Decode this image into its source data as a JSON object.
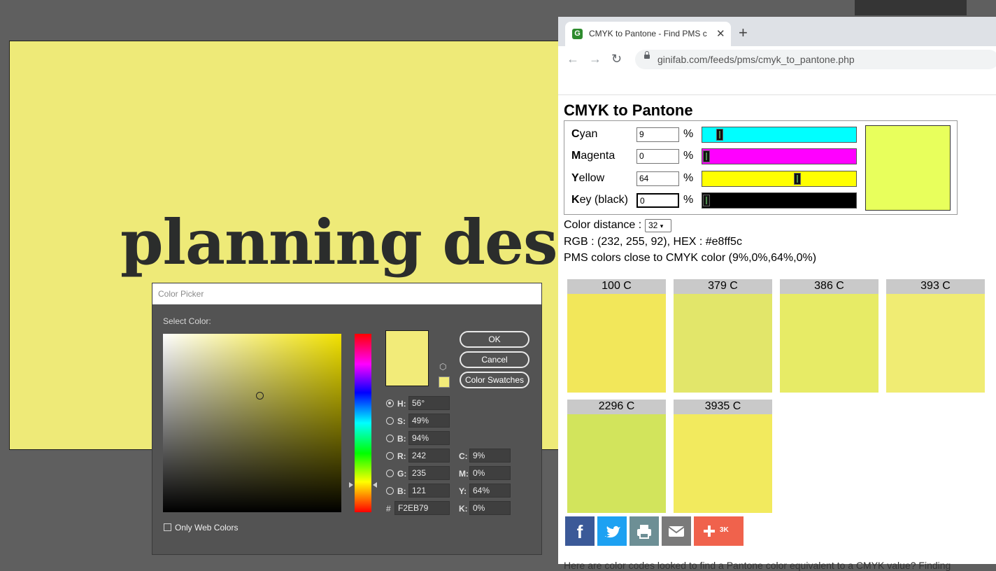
{
  "canvas": {
    "headline": "planning design",
    "background": "#eeea78",
    "text_color": "#2b2d2c"
  },
  "picker": {
    "title": "Color Picker",
    "select_label": "Select Color:",
    "ok_label": "OK",
    "cancel_label": "Cancel",
    "swatches_label": "Color Swatches",
    "only_web_colors_label": "Only Web Colors",
    "current_color": "#f2eb79",
    "fields": {
      "h_label": "H:",
      "h_value": "56°",
      "s_label": "S:",
      "s_value": "49%",
      "b_label": "B:",
      "b_value": "94%",
      "r_label": "R:",
      "r_value": "242",
      "g_label": "G:",
      "g_value": "235",
      "bl_label": "B:",
      "bl_value": "121",
      "hex_label": "#",
      "hex_value": "F2EB79",
      "c_label": "C:",
      "c_value": "9%",
      "m_label": "M:",
      "m_value": "0%",
      "y_label": "Y:",
      "y_value": "64%",
      "k_label": "K:",
      "k_value": "0%"
    }
  },
  "browser": {
    "tab_title": "CMYK to Pantone - Find PMS c",
    "url": "ginifab.com/feeds/pms/cmyk_to_pantone.php",
    "favicon_letter": "G"
  },
  "page": {
    "title": "CMYK to Pantone",
    "cyan_bold": "C",
    "cyan_rest": "yan",
    "cyan_value": "9",
    "magenta_bold": "M",
    "magenta_rest": "agenta",
    "magenta_value": "0",
    "yellow_bold": "Y",
    "yellow_rest": "ellow",
    "yellow_value": "64",
    "key_bold": "K",
    "key_rest": "ey (black)",
    "key_value": "0",
    "percent": "%",
    "result_color": "#e8ff5c",
    "color_distance_label": "Color distance :",
    "color_distance_value": "32",
    "rgb_line": "RGB : (232, 255, 92), HEX : #e8ff5c",
    "pms_line": "PMS colors close to CMYK color (9%,0%,64%,0%)",
    "pms_colors": [
      {
        "name": "100 C",
        "hex": "#f2e75a"
      },
      {
        "name": "379 C",
        "hex": "#e2e66a"
      },
      {
        "name": "386 C",
        "hex": "#e7eb66"
      },
      {
        "name": "393 C",
        "hex": "#f0ec73"
      },
      {
        "name": "2296 C",
        "hex": "#d2e45c"
      },
      {
        "name": "3935 C",
        "hex": "#f2ea5e"
      }
    ],
    "share_count": "3K",
    "bottom_text": "Here are color codes looked to find a Pantone color equivalent to a CMYK value? Finding"
  }
}
